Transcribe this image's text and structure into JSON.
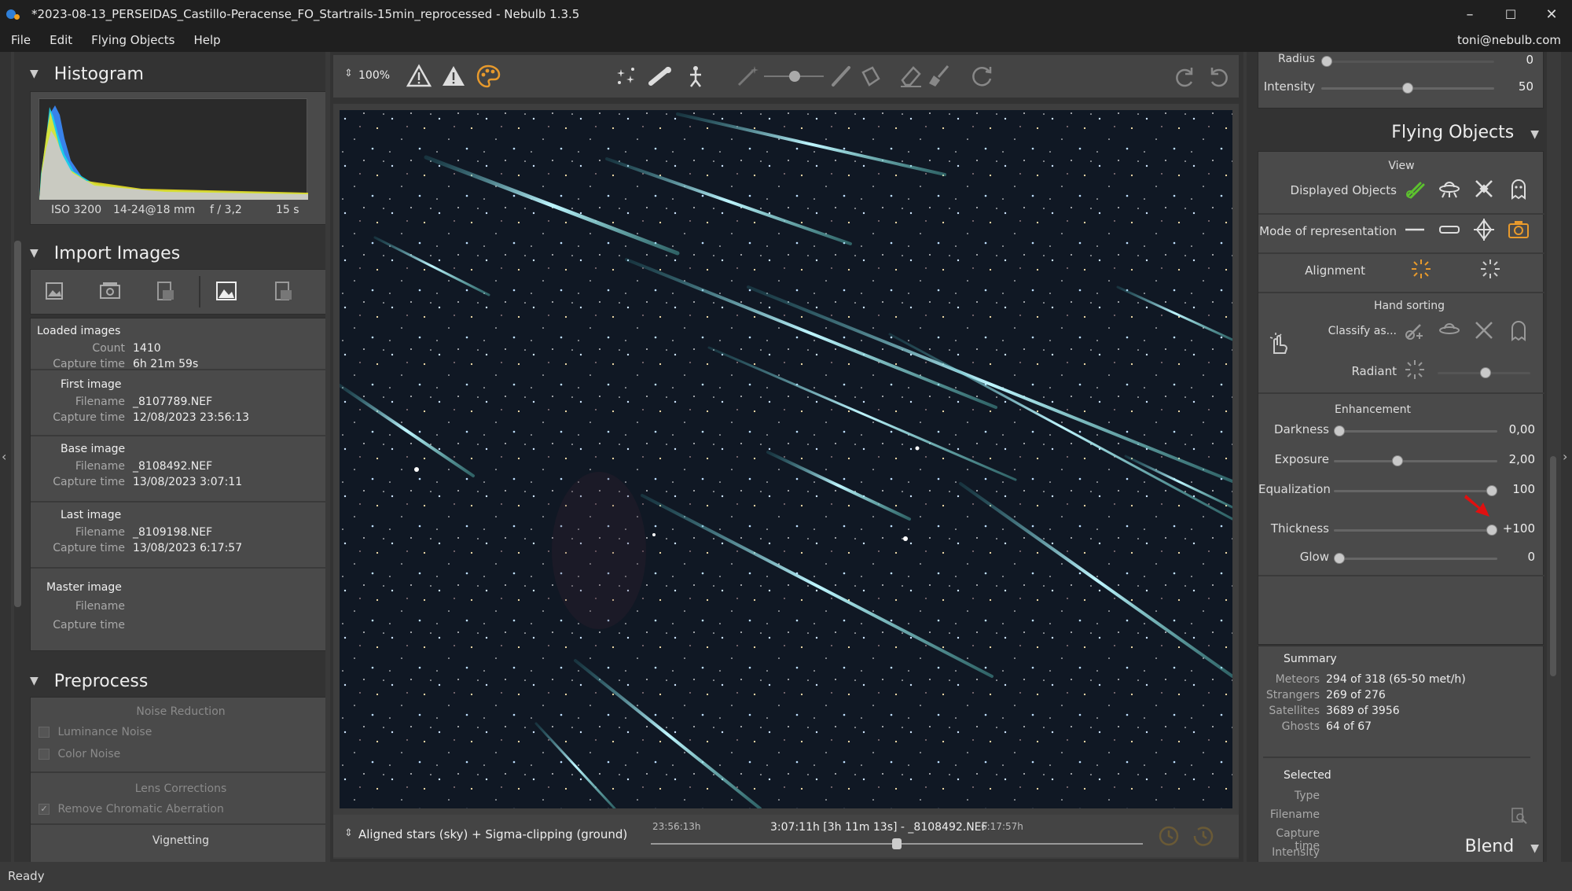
{
  "window": {
    "title": "*2023-08-13_PERSEIDAS_Castillo-Peracense_FO_Startrails-15min_reprocessed - Nebulb 1.3.5",
    "controls": [
      "–",
      "☐",
      "✕"
    ]
  },
  "menu": {
    "items": [
      "File",
      "Edit",
      "Flying Objects",
      "Help"
    ],
    "user": "toni@nebulb.com"
  },
  "histogram": {
    "title": "Histogram",
    "iso": "ISO 3200",
    "lens": "14-24@18 mm",
    "aperture": "f / 3,2",
    "exposure": "15 s"
  },
  "import": {
    "title": "Import Images",
    "loaded": {
      "label": "Loaded images",
      "count_key": "Count",
      "count": "1410",
      "time_key": "Capture time",
      "time": "6h 21m 59s"
    },
    "first": {
      "label": "First image",
      "file_key": "Filename",
      "file": "_8107789.NEF",
      "time_key": "Capture time",
      "time": "12/08/2023 23:56:13"
    },
    "base": {
      "label": "Base image",
      "file_key": "Filename",
      "file": "_8108492.NEF",
      "time_key": "Capture time",
      "time": "13/08/2023 3:07:11"
    },
    "last": {
      "label": "Last image",
      "file_key": "Filename",
      "file": "_8109198.NEF",
      "time_key": "Capture time",
      "time": "13/08/2023 6:17:57"
    },
    "master": {
      "label": "Master image",
      "file_key": "Filename",
      "time_key": "Capture time"
    }
  },
  "preprocess": {
    "title": "Preprocess",
    "noise_title": "Noise Reduction",
    "luminance": "Luminance Noise",
    "color": "Color Noise",
    "lens_title": "Lens Corrections",
    "chromatic": "Remove Chromatic Aberration",
    "vignetting": "Vignetting"
  },
  "toolbar": {
    "zoom": "100%"
  },
  "bottom": {
    "stack_mode": "Aligned stars (sky) + Sigma-clipping (ground)",
    "start_time": "23:56:13h",
    "current": "3:07:11h [3h 11m 13s] - _8108492.NEF",
    "end_time": "6:17:57h",
    "timeline_position": 0.5
  },
  "right": {
    "radius_label": "Radius",
    "radius_value": "0",
    "intensity_label": "Intensity",
    "intensity_value": "50",
    "flying_title": "Flying Objects",
    "view_title": "View",
    "displayed_objects": "Displayed Objects",
    "mode_rep": "Mode of representation",
    "alignment": "Alignment",
    "hand_sorting": "Hand sorting",
    "classify": "Classify as...",
    "radiant": "Radiant",
    "enhancement": "Enhancement",
    "sliders": [
      {
        "label": "Darkness",
        "value": "0,00",
        "pos": 0.0
      },
      {
        "label": "Exposure",
        "value": "2,00",
        "pos": 0.38
      },
      {
        "label": "Equalization",
        "value": "100",
        "pos": 1.0
      },
      {
        "label": "Thickness",
        "value": "+100",
        "pos": 1.0
      },
      {
        "label": "Glow",
        "value": "0",
        "pos": 0.0
      }
    ],
    "summary": {
      "title": "Summary",
      "rows": [
        {
          "k": "Meteors",
          "v": "294 of 318 (65-50 met/h)"
        },
        {
          "k": "Strangers",
          "v": "269 of 276"
        },
        {
          "k": "Satellites",
          "v": "3689 of 3956"
        },
        {
          "k": "Ghosts",
          "v": "64 of 67"
        }
      ]
    },
    "selected": {
      "title": "Selected",
      "rows": [
        "Type",
        "Filename",
        "Capture time",
        "Intensity"
      ]
    },
    "blend_title": "Blend"
  },
  "status": "Ready",
  "colors": {
    "accent_orange": "#e89a2c",
    "accent_green": "#5cc22e",
    "annotation_red": "#e01010"
  }
}
